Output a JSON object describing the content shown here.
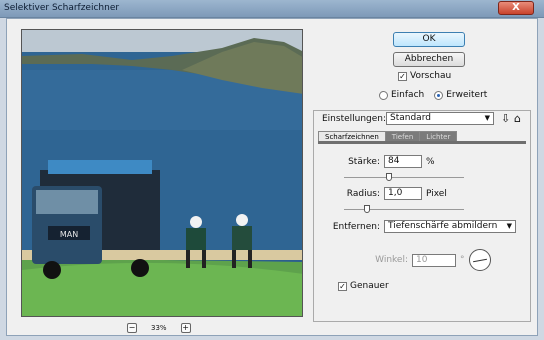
{
  "window": {
    "title": "Selektiver Scharfzeichner",
    "close": "X"
  },
  "buttons": {
    "ok": "OK",
    "cancel": "Abbrechen"
  },
  "preview": {
    "label": "Vorschau",
    "checked": true
  },
  "mode": {
    "simple": "Einfach",
    "advanced": "Erweitert",
    "selected": "advanced"
  },
  "settings": {
    "label": "Einstellungen:",
    "value": "Standard"
  },
  "tabs": [
    {
      "label": "Scharfzeichnen",
      "active": true
    },
    {
      "label": "Tiefen",
      "active": false
    },
    {
      "label": "Lichter",
      "active": false
    }
  ],
  "strength": {
    "label": "Stärke:",
    "value": "84",
    "unit": "%"
  },
  "radius": {
    "label": "Radius:",
    "value": "1,0",
    "unit": "Pixel"
  },
  "remove": {
    "label": "Entfernen:",
    "value": "Tiefenschärfe abmildern"
  },
  "angle": {
    "label": "Winkel:",
    "value": "10",
    "unit": "°"
  },
  "more_accurate": {
    "label": "Genauer",
    "checked": true
  },
  "zoom": {
    "minus": "−",
    "level": "33%",
    "plus": "+"
  },
  "truck_text": "MAN",
  "colors": {
    "ok_button": "#bee6fd",
    "titlebar": "#8fa9c4",
    "close": "#c8432c"
  }
}
